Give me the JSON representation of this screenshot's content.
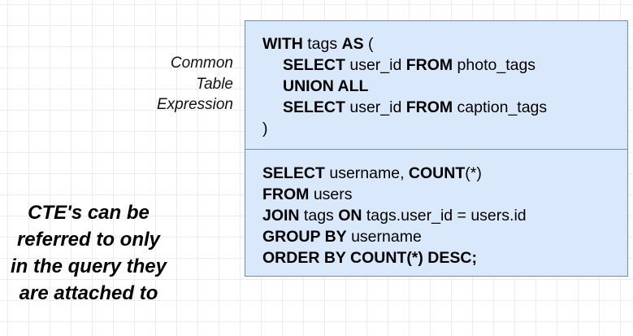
{
  "cte_label": [
    "Common",
    "Table",
    "Expression"
  ],
  "note": [
    "CTE's can be",
    "referred to only",
    "in the query they",
    "are attached to"
  ],
  "cte_query": [
    {
      "indent": false,
      "parts": [
        {
          "t": "WITH",
          "b": true
        },
        {
          "t": " tags "
        },
        {
          "t": "AS",
          "b": true
        },
        {
          "t": " ("
        }
      ]
    },
    {
      "indent": true,
      "parts": [
        {
          "t": "SELECT",
          "b": true
        },
        {
          "t": " user_id "
        },
        {
          "t": "FROM",
          "b": true
        },
        {
          "t": " photo_tags"
        }
      ]
    },
    {
      "indent": true,
      "parts": [
        {
          "t": "UNION ALL",
          "b": true
        }
      ]
    },
    {
      "indent": true,
      "parts": [
        {
          "t": "SELECT",
          "b": true
        },
        {
          "t": " user_id "
        },
        {
          "t": "FROM",
          "b": true
        },
        {
          "t": " caption_tags"
        }
      ]
    },
    {
      "indent": false,
      "parts": [
        {
          "t": ")"
        }
      ]
    }
  ],
  "main_query": [
    {
      "indent": false,
      "parts": [
        {
          "t": "SELECT",
          "b": true
        },
        {
          "t": " username, "
        },
        {
          "t": "COUNT",
          "b": true
        },
        {
          "t": "(*)"
        }
      ]
    },
    {
      "indent": false,
      "parts": [
        {
          "t": "FROM",
          "b": true
        },
        {
          "t": " users"
        }
      ]
    },
    {
      "indent": false,
      "parts": [
        {
          "t": "JOIN",
          "b": true
        },
        {
          "t": " tags "
        },
        {
          "t": "ON",
          "b": true
        },
        {
          "t": " tags.user_id = users.id"
        }
      ]
    },
    {
      "indent": false,
      "parts": [
        {
          "t": "GROUP BY",
          "b": true
        },
        {
          "t": " username"
        }
      ]
    },
    {
      "indent": false,
      "parts": [
        {
          "t": "ORDER BY COUNT(*) DESC;",
          "b": true
        }
      ]
    }
  ],
  "colors": {
    "box_fill": "#dae8fc",
    "box_border": "#6c8ebf"
  }
}
